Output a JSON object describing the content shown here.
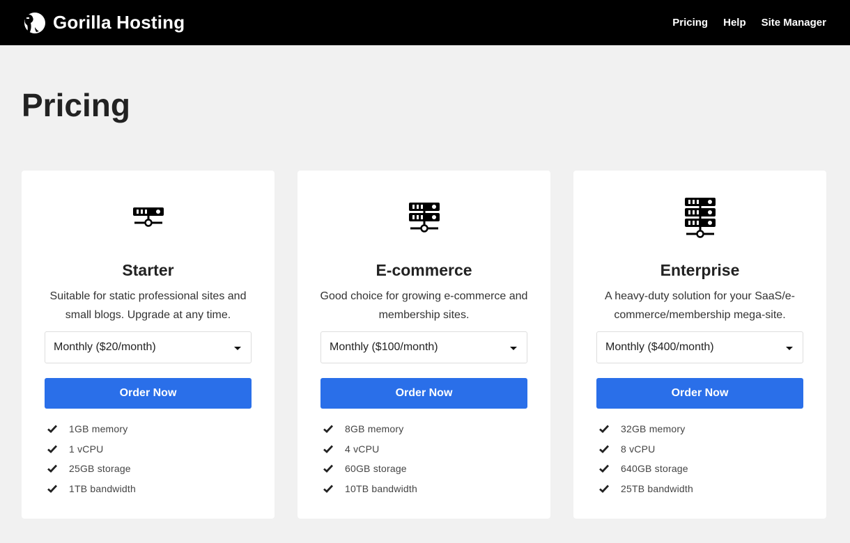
{
  "navbar": {
    "brand_name": "Gorilla Hosting",
    "logo_icon": "gorilla-logo-icon",
    "links": [
      {
        "label": "Pricing"
      },
      {
        "label": "Help"
      },
      {
        "label": "Site Manager"
      }
    ]
  },
  "page": {
    "title": "Pricing"
  },
  "plans": [
    {
      "name": "Starter",
      "icon": "server-1-rack-icon",
      "description": "Suitable for static professional sites and small blogs. Upgrade at any time.",
      "billing_selected": "Monthly ($20/month)",
      "order_label": "Order Now",
      "features": [
        "1GB memory",
        "1 vCPU",
        "25GB storage",
        "1TB bandwidth"
      ]
    },
    {
      "name": "E-commerce",
      "icon": "server-2-rack-icon",
      "description": "Good choice for growing e-commerce and membership sites.",
      "billing_selected": "Monthly ($100/month)",
      "order_label": "Order Now",
      "features": [
        "8GB memory",
        "4 vCPU",
        "60GB storage",
        "10TB bandwidth"
      ]
    },
    {
      "name": "Enterprise",
      "icon": "server-3-rack-icon",
      "description": "A heavy-duty solution for your SaaS/e-commerce/membership mega-site.",
      "billing_selected": "Monthly ($400/month)",
      "order_label": "Order Now",
      "features": [
        "32GB memory",
        "8 vCPU",
        "640GB storage",
        "25TB bandwidth"
      ]
    }
  ],
  "colors": {
    "navbar_bg": "#000000",
    "page_bg": "#f1f1f1",
    "accent": "#2a6fe9"
  }
}
